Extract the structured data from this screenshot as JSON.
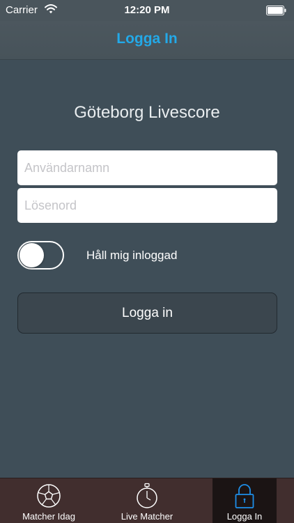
{
  "status_bar": {
    "carrier": "Carrier",
    "time": "12:20 PM"
  },
  "nav": {
    "title": "Logga In"
  },
  "app_title": "Göteborg Livescore",
  "form": {
    "username_placeholder": "Användarnamn",
    "username_value": "",
    "password_placeholder": "Lösenord",
    "password_value": "",
    "remember_label": "Håll mig inloggad",
    "remember_on": false,
    "login_button": "Logga in"
  },
  "tabs": [
    {
      "label": "Matcher Idag",
      "icon": "soccer-ball-icon",
      "selected": false
    },
    {
      "label": "Live Matcher",
      "icon": "stopwatch-icon",
      "selected": false
    },
    {
      "label": "Logga In",
      "icon": "lock-icon",
      "selected": true
    }
  ],
  "colors": {
    "accent": "#23a9e8",
    "background": "#3f4e58",
    "tab_bar": "#412e2e"
  }
}
